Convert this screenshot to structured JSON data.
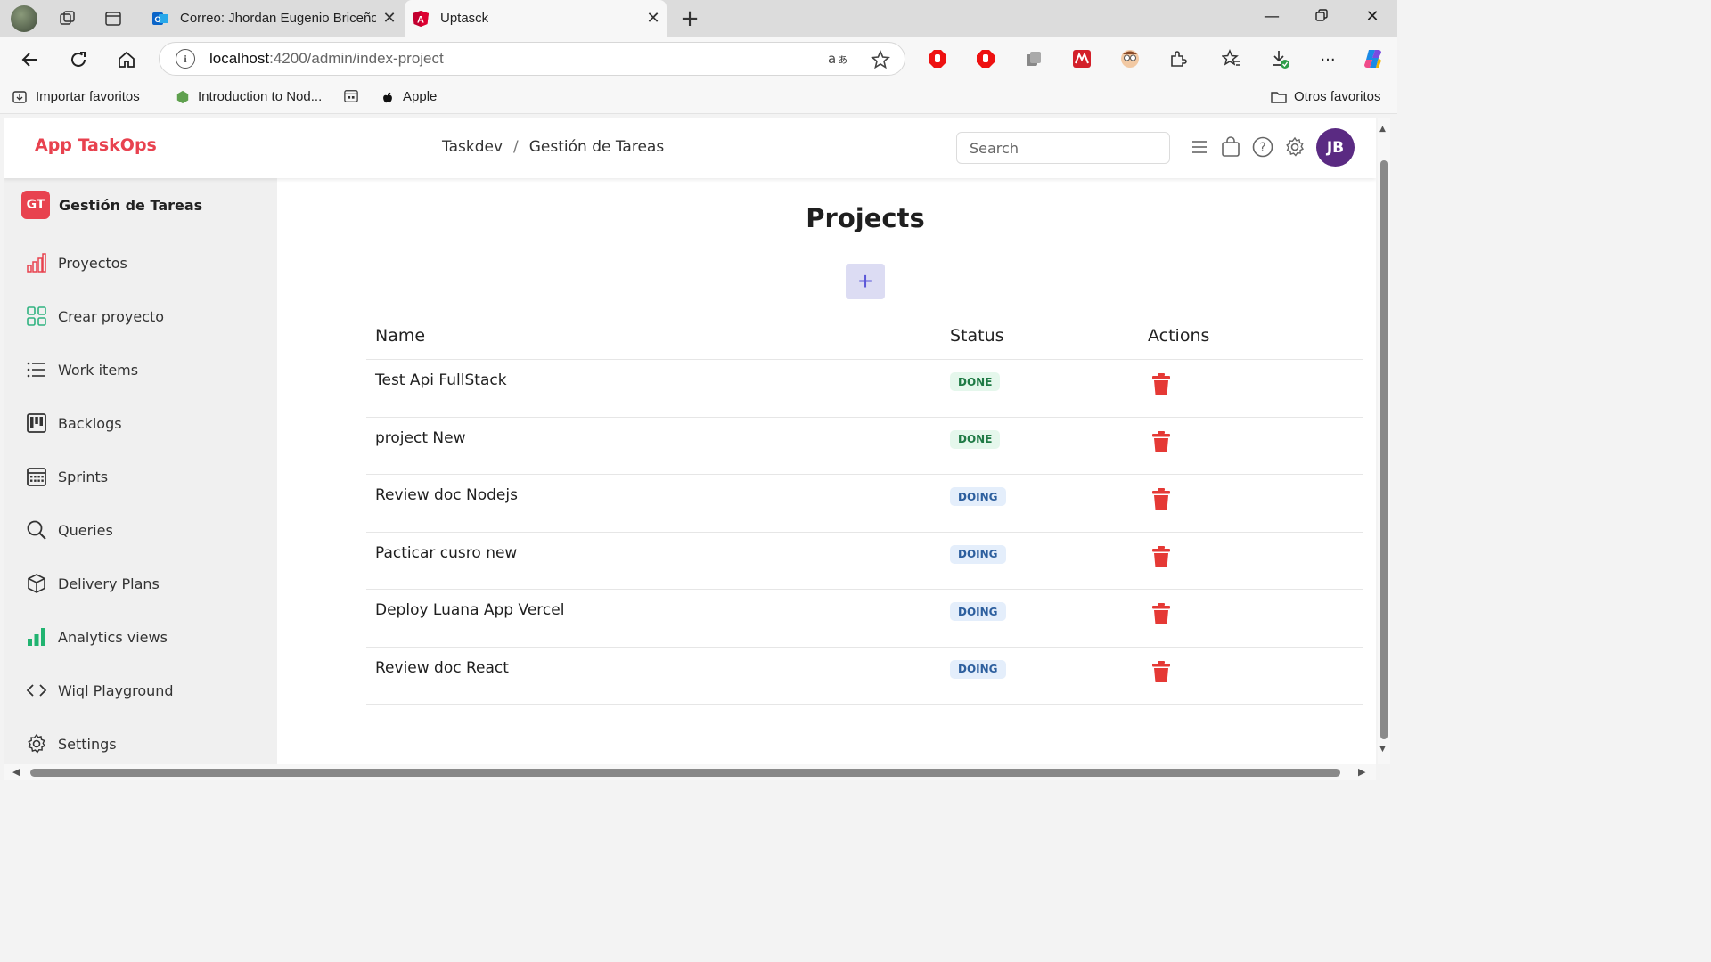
{
  "browser": {
    "tabs": [
      {
        "title": "Correo: Jhordan Eugenio Briceño",
        "close": "✕"
      },
      {
        "title": "Uptasck",
        "close": "✕"
      }
    ],
    "new_tab": "+",
    "url_host": "localhost",
    "url_path": ":4200/admin/index-project",
    "bookmarks": {
      "import": "Importar favoritos",
      "node": "Introduction to Nod...",
      "apple": "Apple",
      "other": "Otros favoritos"
    }
  },
  "header": {
    "brand": "App TaskOps",
    "breadcrumb": [
      "Taskdev",
      "/",
      "Gestión de Tareas"
    ],
    "search_placeholder": "Search",
    "user_initials": "JB"
  },
  "sidebar": {
    "project_badge": "GT",
    "project_name": "Gestión de Tareas",
    "items": [
      {
        "label": "Proyectos",
        "icon": "bar-chart-icon"
      },
      {
        "label": "Crear proyecto",
        "icon": "grid-icon"
      },
      {
        "label": "Work items",
        "icon": "list-icon"
      },
      {
        "label": "Backlogs",
        "icon": "kanban-icon"
      },
      {
        "label": "Sprints",
        "icon": "calendar-icon"
      },
      {
        "label": "Queries",
        "icon": "search-icon"
      },
      {
        "label": "Delivery Plans",
        "icon": "box-icon"
      },
      {
        "label": "Analytics views",
        "icon": "analytics-icon"
      },
      {
        "label": "Wiql Playground",
        "icon": "code-icon"
      },
      {
        "label": "Settings",
        "icon": "gear-icon"
      }
    ]
  },
  "main": {
    "title": "Projects",
    "add_label": "+",
    "columns": [
      "Name",
      "Status",
      "Actions"
    ],
    "rows": [
      {
        "name": "Test Api FullStack",
        "status": "DONE"
      },
      {
        "name": "project New",
        "status": "DONE"
      },
      {
        "name": "Review doc Nodejs",
        "status": "DOING"
      },
      {
        "name": "Pacticar cusro new",
        "status": "DOING"
      },
      {
        "name": "Deploy Luana App Vercel",
        "status": "DOING"
      },
      {
        "name": "Review doc React",
        "status": "DOING"
      }
    ]
  },
  "colors": {
    "brand": "#e8424f",
    "done_bg": "#e5f7ec",
    "done_text": "#1f7a45",
    "doing_bg": "#e4eefb",
    "doing_text": "#2d5f9e",
    "delete": "#e53935",
    "avatar": "#5a2a82"
  }
}
